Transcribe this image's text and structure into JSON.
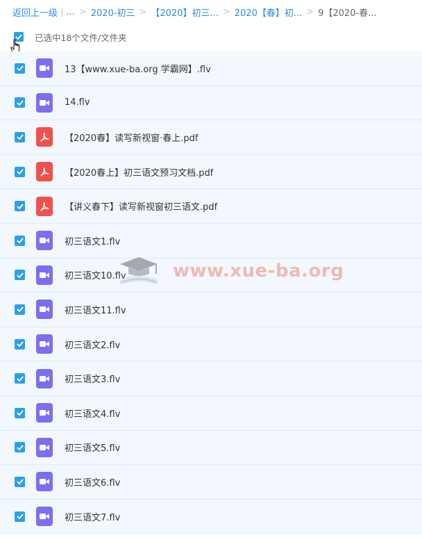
{
  "breadcrumb": {
    "back_label": "返回上一级",
    "ellipsis": "...",
    "items": [
      "2020-初三",
      "【2020】初三...",
      "2020【春】初...",
      "9【2020-春..."
    ]
  },
  "selection": {
    "label": "已选中18个文件/文件夹",
    "checked": true
  },
  "files": [
    {
      "name": "13【www.xue-ba.org 学霸网】.flv",
      "type": "video",
      "checked": true
    },
    {
      "name": "14.flv",
      "type": "video",
      "checked": true
    },
    {
      "name": "【2020春】读写新视窗·春上.pdf",
      "type": "pdf",
      "checked": true
    },
    {
      "name": "【2020春上】初三语文预习文档.pdf",
      "type": "pdf",
      "checked": true
    },
    {
      "name": "【讲义春下】读写新视窗初三语文.pdf",
      "type": "pdf",
      "checked": true
    },
    {
      "name": "初三语文1.flv",
      "type": "video",
      "checked": true
    },
    {
      "name": "初三语文10.flv",
      "type": "video",
      "checked": true
    },
    {
      "name": "初三语文11.flv",
      "type": "video",
      "checked": true
    },
    {
      "name": "初三语文2.flv",
      "type": "video",
      "checked": true
    },
    {
      "name": "初三语文3.flv",
      "type": "video",
      "checked": true
    },
    {
      "name": "初三语文4.flv",
      "type": "video",
      "checked": true
    },
    {
      "name": "初三语文5.flv",
      "type": "video",
      "checked": true
    },
    {
      "name": "初三语文6.flv",
      "type": "video",
      "checked": true
    },
    {
      "name": "初三语文7.flv",
      "type": "video",
      "checked": true
    }
  ],
  "watermark": {
    "text": "www.xue-ba.org",
    "icon": "graduation-cap-book-logo"
  },
  "icons": {
    "video": "video-camera-icon",
    "pdf": "pdf-acrobat-icon",
    "check": "check-icon",
    "cursor": "hand-pointer-cursor"
  },
  "colors": {
    "link": "#2a8ce5",
    "checkbox": "#2aa0ea",
    "row_bg": "#f2f8fd",
    "row_border": "#dcebf7",
    "video_icon": "#7b6ff0",
    "pdf_icon": "#f0514d"
  }
}
